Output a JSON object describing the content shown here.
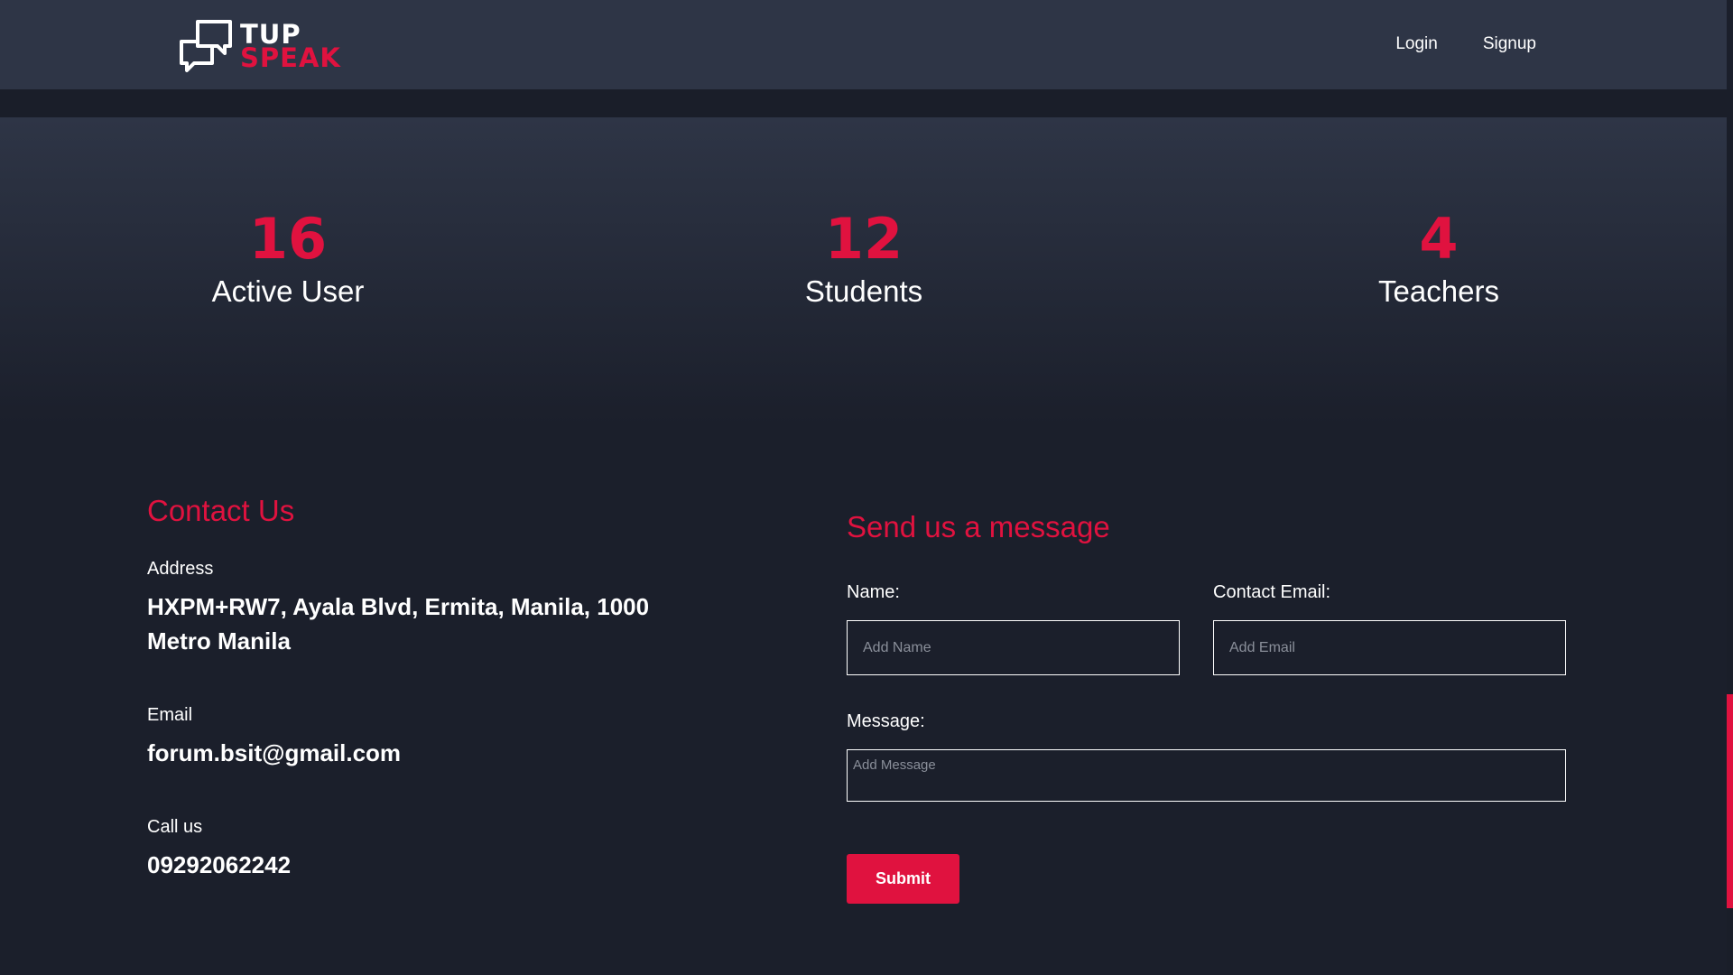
{
  "brand": {
    "name_line1": "TUP",
    "name_line2": "SPEAK",
    "icon": "speech-bubbles-icon"
  },
  "nav": {
    "login": "Login",
    "signup": "Signup"
  },
  "stats": [
    {
      "value": "16",
      "label": "Active User"
    },
    {
      "value": "12",
      "label": "Students"
    },
    {
      "value": "4",
      "label": "Teachers"
    }
  ],
  "contact": {
    "title": "Contact Us",
    "address_label": "Address",
    "address_line1": "HXPM+RW7, Ayala Blvd, Ermita, Manila, 1000",
    "address_line2": "Metro Manila",
    "email_label": "Email",
    "email_value": "forum.bsit@gmail.com",
    "call_label": "Call us",
    "call_value": "09292062242"
  },
  "form": {
    "title": "Send us a message",
    "name_label": "Name:",
    "name_placeholder": "Add Name",
    "email_label": "Contact Email:",
    "email_placeholder": "Add Email",
    "message_label": "Message:",
    "message_placeholder": "Add Message",
    "submit_label": "Submit"
  },
  "colors": {
    "accent": "#e0123f",
    "nav_bg": "#2e3546",
    "page_bg": "#1b1f2b"
  }
}
